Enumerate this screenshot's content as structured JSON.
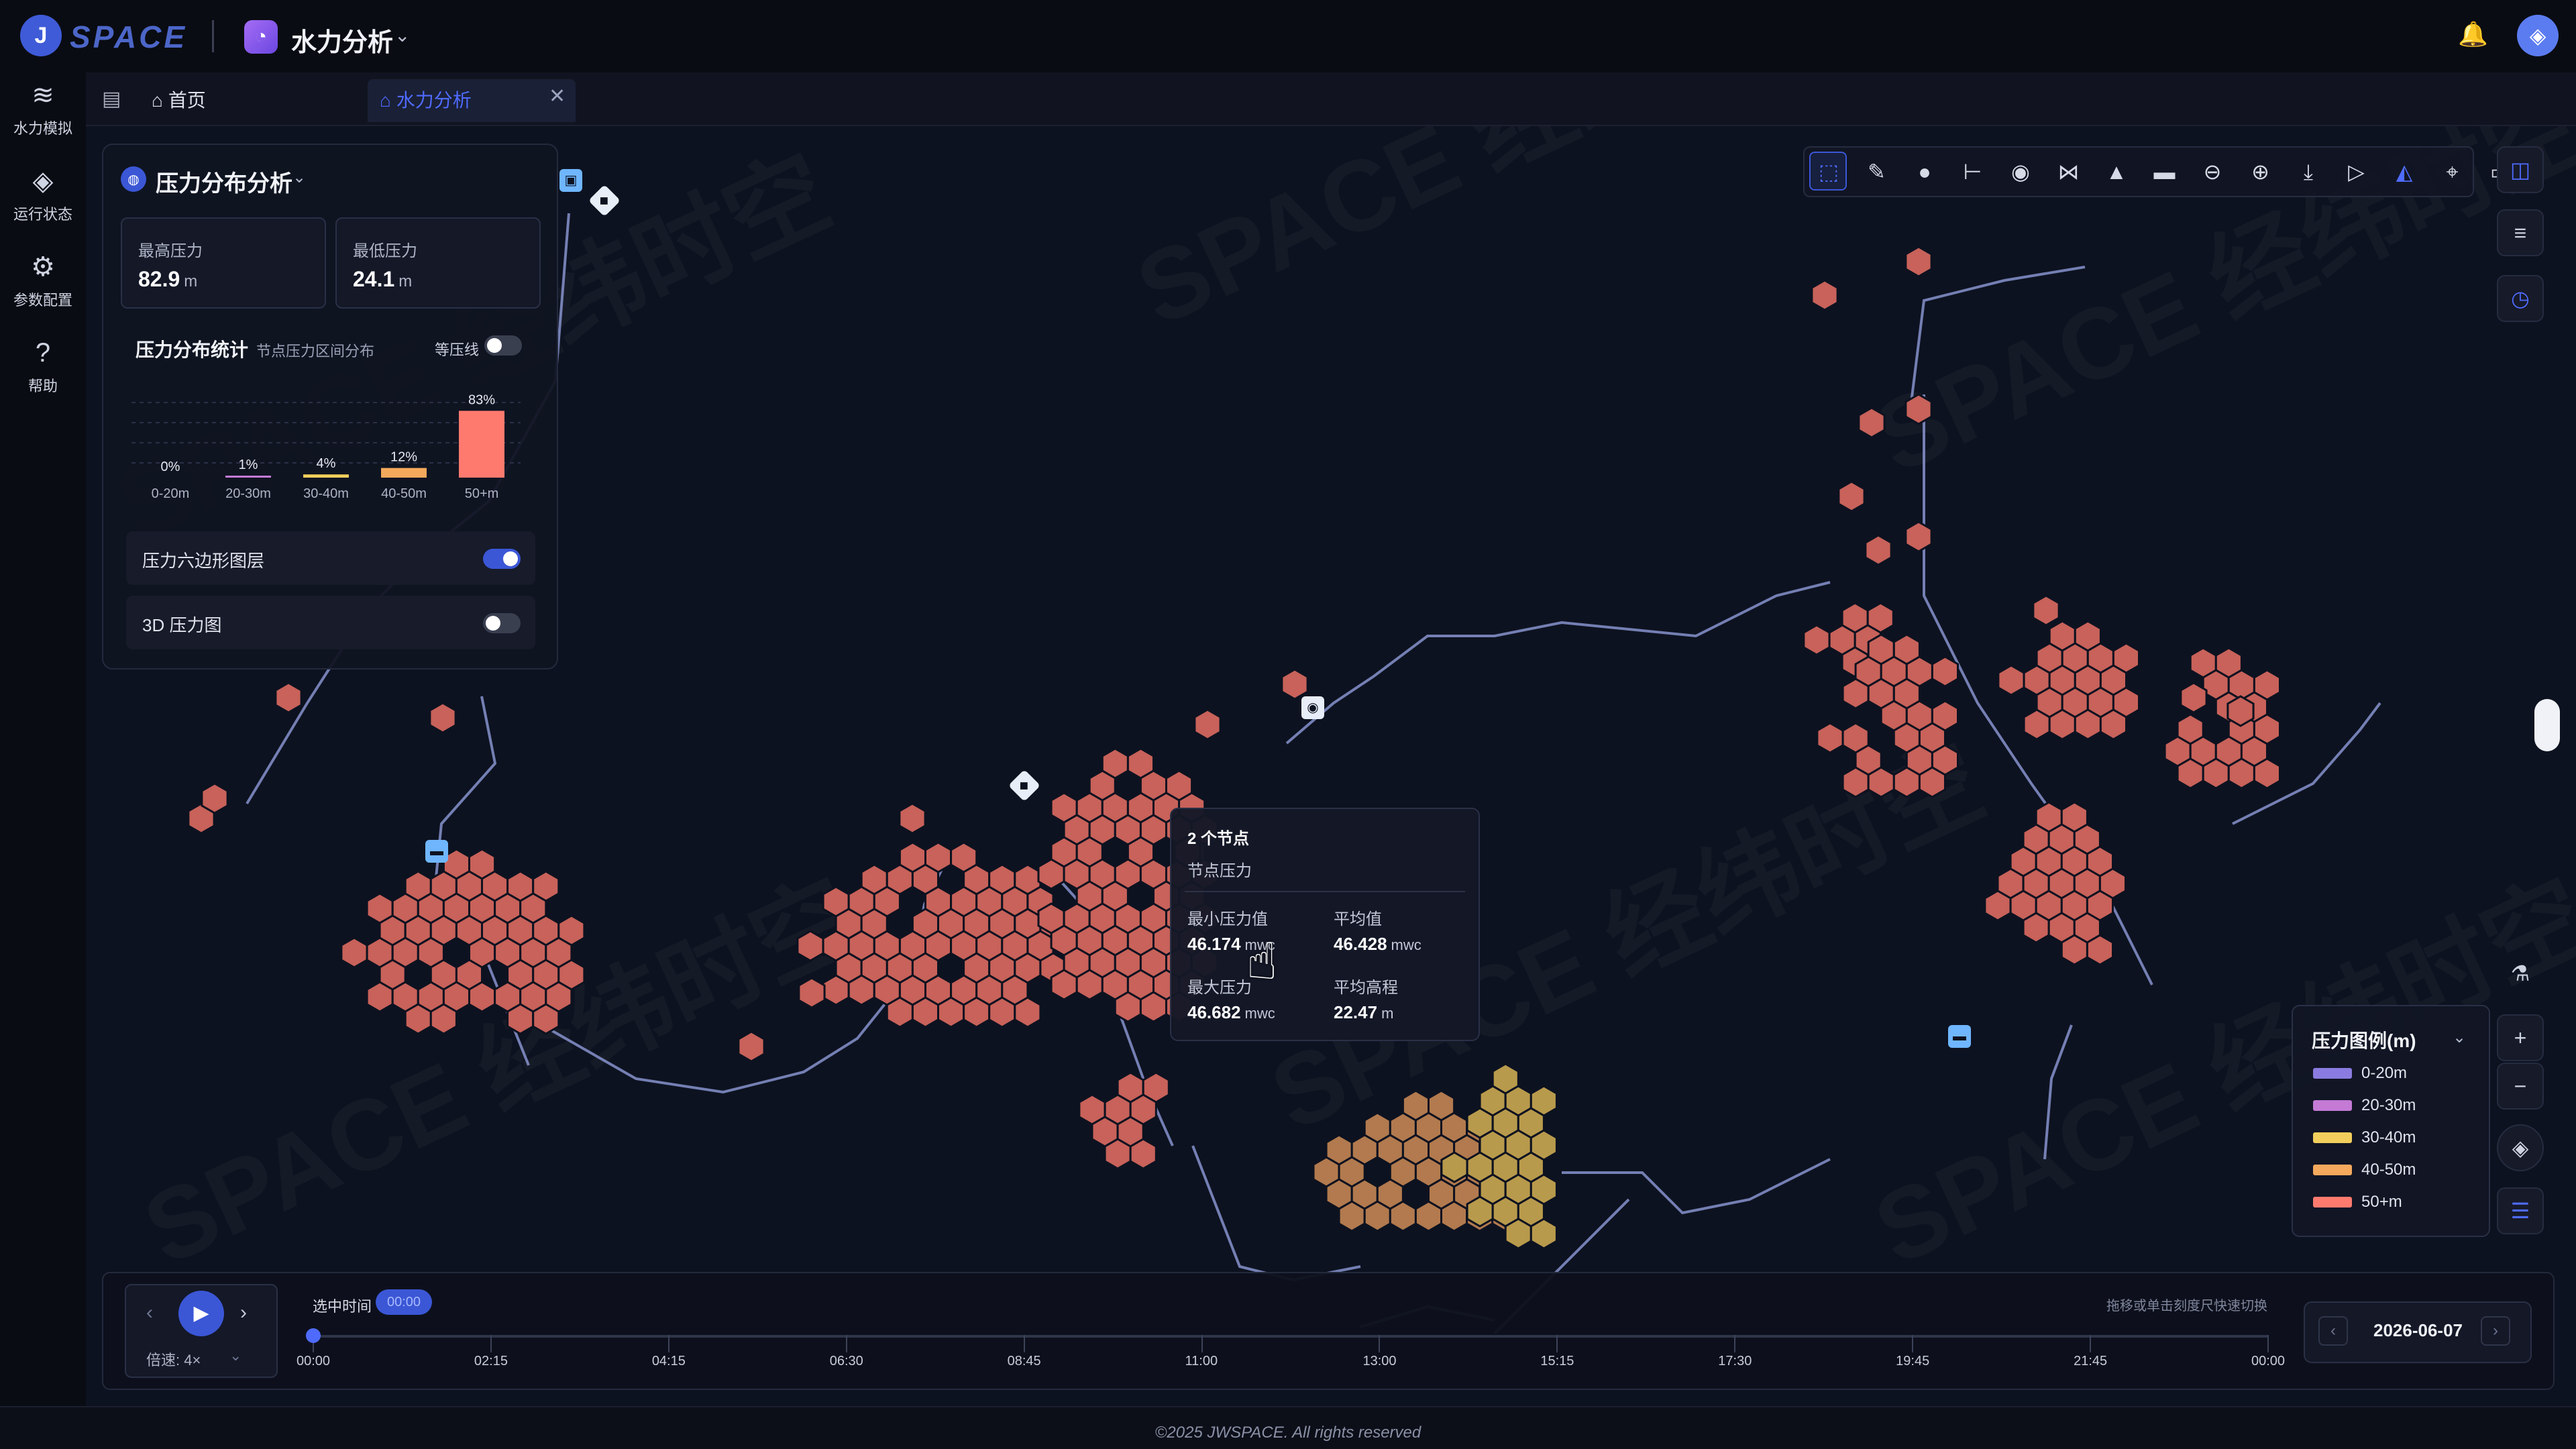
{
  "brand": {
    "logo_glyph": "J",
    "name": "SPACE"
  },
  "app": {
    "title": "水力分析",
    "icon": "app-swirl-icon"
  },
  "sidebar": {
    "items": [
      {
        "label": "水力模拟",
        "icon": "wave-icon",
        "glyph": "≋"
      },
      {
        "label": "运行状态",
        "icon": "droplet-icon",
        "glyph": "◈"
      },
      {
        "label": "参数配置",
        "icon": "gear-icon",
        "glyph": "⚙"
      },
      {
        "label": "帮助",
        "icon": "help-icon",
        "glyph": "?"
      }
    ]
  },
  "tabs": {
    "menu_glyph": "▤",
    "home": "首页",
    "active": "水力分析",
    "close_glyph": "✕"
  },
  "panel": {
    "title": "压力分布分析",
    "chev": "⌄",
    "max_label": "最高压力",
    "max_value": "82.9",
    "max_unit": "m",
    "min_label": "最低压力",
    "min_value": "24.1",
    "min_unit": "m",
    "dist_title": "压力分布统计",
    "dist_sub": "节点压力区间分布",
    "isoline_label": "等压线",
    "hex_layer_label": "压力六边形图层",
    "pressure_3d_label": "3D 压力图"
  },
  "chart_data": {
    "type": "bar",
    "categories": [
      "0-20m",
      "20-30m",
      "30-40m",
      "40-50m",
      "50+m"
    ],
    "values": [
      0,
      1,
      4,
      12,
      83
    ],
    "value_labels": [
      "0%",
      "1%",
      "4%",
      "12%",
      "83%"
    ],
    "ylim": [
      0,
      100
    ],
    "colors": [
      "#8a7be0",
      "#c57ad6",
      "#f2cf5c",
      "#f5a95c",
      "#ff7a6e"
    ]
  },
  "tooltip": {
    "title": "2 个节点",
    "subtitle": "节点压力",
    "min_label": "最小压力值",
    "min_value": "46.174",
    "min_unit": "mwc",
    "avg_label": "平均值",
    "avg_value": "46.428",
    "avg_unit": "mwc",
    "max_label": "最大压力",
    "max_value": "46.682",
    "max_unit": "mwc",
    "elev_label": "平均高程",
    "elev_value": "22.47",
    "elev_unit": "m"
  },
  "legend": {
    "title": "压力图例(m)",
    "chev": "⌄",
    "items": [
      {
        "label": "0-20m",
        "color": "#8a7be0"
      },
      {
        "label": "20-30m",
        "color": "#c57ad6"
      },
      {
        "label": "30-40m",
        "color": "#f2cf5c"
      },
      {
        "label": "40-50m",
        "color": "#f5a95c"
      },
      {
        "label": "50+m",
        "color": "#ff7a6e"
      }
    ]
  },
  "toolbar": {
    "tools": [
      {
        "icon": "select-icon",
        "glyph": "⬚"
      },
      {
        "icon": "ruler-icon",
        "glyph": "✎"
      },
      {
        "icon": "node-icon",
        "glyph": "●"
      },
      {
        "icon": "pipe-icon",
        "glyph": "⊢"
      },
      {
        "icon": "pump-icon",
        "glyph": "◉"
      },
      {
        "icon": "valve-icon",
        "glyph": "⋈"
      },
      {
        "icon": "tank-icon",
        "glyph": "▲"
      },
      {
        "icon": "reservoir-icon",
        "glyph": "▬"
      },
      {
        "icon": "zoom-out-icon",
        "glyph": "⊖"
      },
      {
        "icon": "zoom-in-icon",
        "glyph": "⊕"
      },
      {
        "icon": "export-icon",
        "glyph": "⤓"
      },
      {
        "icon": "play-circle-icon",
        "glyph": "▷"
      },
      {
        "icon": "pressure-layer-icon",
        "glyph": "◭"
      },
      {
        "icon": "locate-icon",
        "glyph": "⌖"
      },
      {
        "icon": "report-icon",
        "glyph": "▭"
      }
    ]
  },
  "right_controls": {
    "layers_glyph": "◫",
    "stack_glyph": "≡",
    "history_glyph": "◷",
    "flask_glyph": "⚗",
    "zoom_in_glyph": "+",
    "zoom_out_glyph": "−",
    "compass_glyph": "◈",
    "list_glyph": "☰"
  },
  "timeline": {
    "prev_glyph": "‹",
    "play_glyph": "▶",
    "next_glyph": "›",
    "speed": "倍速: 4×",
    "speed_chev": "⌄",
    "selected_label": "选中时间",
    "selected_value": "00:00",
    "hint": "拖移或单击刻度尺快速切换",
    "ticks": [
      "00:00",
      "02:15",
      "04:15",
      "06:30",
      "08:45",
      "11:00",
      "13:00",
      "15:15",
      "17:30",
      "19:45",
      "21:45",
      "00:00"
    ],
    "date": "2026-06-07",
    "date_prev": "‹",
    "date_next": "›"
  },
  "watermark": "SPACE 经纬时空",
  "footer": {
    "copyright": "©2025 JWSPACE. All rights reserved"
  },
  "header": {
    "bell_icon": "bell-icon",
    "bell_glyph": "🔔",
    "avatar_glyph": "◈"
  }
}
